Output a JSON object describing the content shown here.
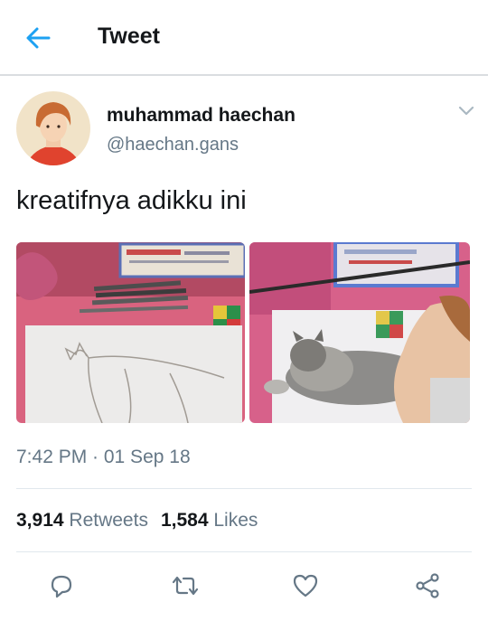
{
  "header": {
    "title": "Tweet"
  },
  "user": {
    "name": "muhammad haechan",
    "handle": "@haechan.gans"
  },
  "tweet": {
    "text": "kreatifnya adikku ini",
    "timestamp": "7:42 PM · 01 Sep 18"
  },
  "stats": {
    "retweets_count": "3,914",
    "retweets_label": "Retweets",
    "likes_count": "1,584",
    "likes_label": "Likes"
  },
  "icons": [
    "back-arrow-icon",
    "caret-down-icon",
    "reply-icon",
    "retweet-icon",
    "like-icon",
    "share-icon"
  ],
  "colors": {
    "accent": "#1da1f2",
    "text": "#14171a",
    "secondary": "#657786",
    "divider": "#e1e8ed"
  }
}
